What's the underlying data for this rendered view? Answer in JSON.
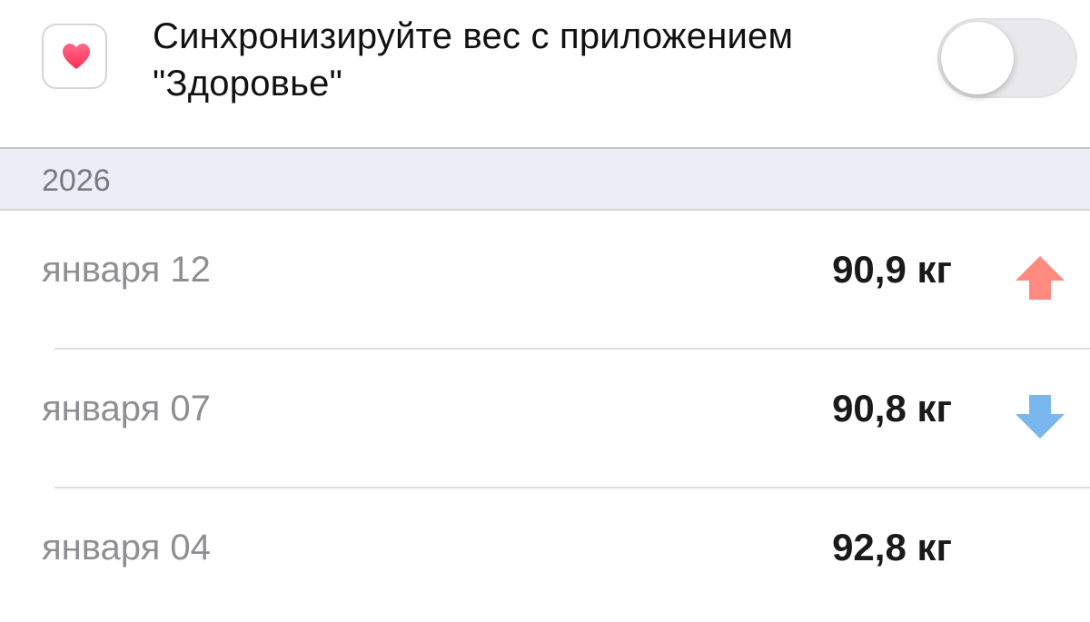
{
  "sync": {
    "label": "Синхронизируйте вес с приложением \"Здоровье\"",
    "icon": "health-heart-icon",
    "toggle_on": false
  },
  "section": {
    "year": "2026"
  },
  "entries": [
    {
      "date": "января 12",
      "weight": "90,9 кг",
      "trend": "up",
      "trend_icon": "arrow-up-icon"
    },
    {
      "date": "января 07",
      "weight": "90,8 кг",
      "trend": "down",
      "trend_icon": "arrow-down-icon"
    },
    {
      "date": "января 04",
      "weight": "92,8 кг",
      "trend": "none",
      "trend_icon": ""
    }
  ],
  "colors": {
    "heart": "#ff3b5c",
    "trend_up": "#ff8a80",
    "trend_down": "#7ab6ee",
    "section_bg": "#ecedf5"
  }
}
